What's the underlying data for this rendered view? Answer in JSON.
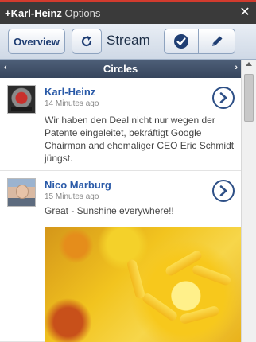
{
  "window": {
    "user_name": "+Karl-Heinz",
    "options_label": "Options",
    "close_glyph": "✕"
  },
  "toolbar": {
    "overview_label": "Overview",
    "stream_label": "Stream",
    "icons": [
      "refresh-icon",
      "check-icon",
      "pencil-icon"
    ]
  },
  "circles_bar": {
    "label": "Circles",
    "left_glyph": "‹",
    "right_glyph": "›"
  },
  "posts": [
    {
      "author": "Karl-Heinz",
      "time": "14 Minutes ago",
      "text": "Wir haben den Deal nicht nur wegen der Patente eingeleitet, bekräftigt Google Chairman and ehemaliger CEO Eric Schmidt jüngst."
    },
    {
      "author": "Nico Marburg",
      "time": "15 Minutes ago",
      "text": "Great - Sunshine everywhere!!",
      "has_photo": true
    }
  ],
  "colors": {
    "title_bar": "#3a3a3a",
    "accent_red": "#d23b2e",
    "circles_bar": "#3f4f68",
    "author_link": "#2a5aa8",
    "button_text": "#1f3e73"
  }
}
